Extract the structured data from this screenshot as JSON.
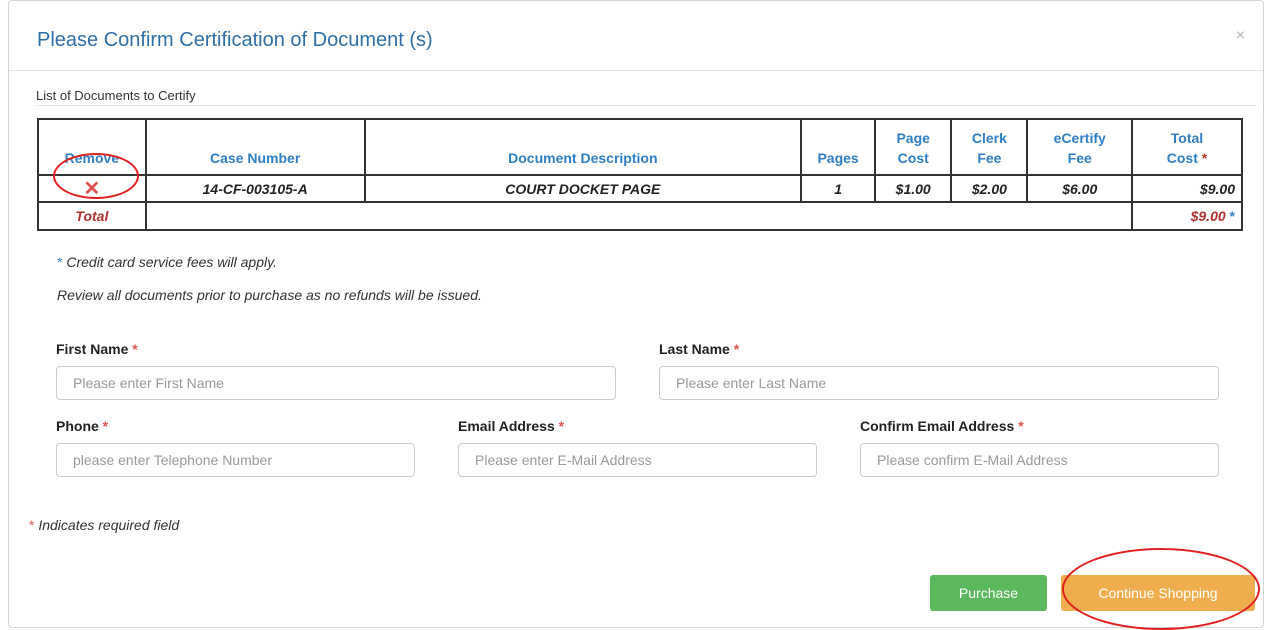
{
  "modal": {
    "title": "Please Confirm Certification of Document (s)",
    "close_glyph": "×"
  },
  "list": {
    "caption": "List of Documents to Certify",
    "headers": {
      "remove": "Remove",
      "case_number": "Case Number",
      "description": "Document Description",
      "pages": "Pages",
      "page_cost_1": "Page",
      "page_cost_2": "Cost",
      "clerk_fee_1": "Clerk",
      "clerk_fee_2": "Fee",
      "ecertify_fee_1": "eCertify",
      "ecertify_fee_2": "Fee",
      "total_cost_1": "Total",
      "total_cost_2": "Cost",
      "star": "*"
    },
    "rows": [
      {
        "remove_glyph": "✕",
        "case_number": "14-CF-003105-A",
        "description": "COURT DOCKET PAGE",
        "pages": "1",
        "page_cost": "$1.00",
        "clerk_fee": "$2.00",
        "ecertify_fee": "$6.00",
        "total_cost": "$9.00"
      }
    ],
    "total_label": "Total",
    "total_value": "$9.00",
    "total_star": "*"
  },
  "notes": {
    "star": "*",
    "credit_card": " Credit card service fees will apply.",
    "review": "Review all documents prior to purchase as no refunds will be issued."
  },
  "form": {
    "first_name": {
      "label": "First Name",
      "req": "*",
      "placeholder": "Please enter First Name",
      "value": ""
    },
    "last_name": {
      "label": "Last Name",
      "req": "*",
      "placeholder": "Please enter Last Name",
      "value": ""
    },
    "phone": {
      "label": "Phone",
      "req": "*",
      "placeholder": "please enter Telephone Number",
      "value": ""
    },
    "email": {
      "label": "Email Address",
      "req": "*",
      "placeholder": "Please enter E-Mail Address",
      "value": ""
    },
    "confirm_email": {
      "label": "Confirm Email Address",
      "req": "*",
      "placeholder": "Please confirm E-Mail Address",
      "value": ""
    }
  },
  "required_note": {
    "star": "*",
    "text": " Indicates required field"
  },
  "buttons": {
    "purchase": "Purchase",
    "continue_shopping": "Continue Shopping"
  },
  "colors": {
    "title": "#2f6fa8",
    "header_text": "#2f7fc6",
    "purchase_button": "#5cb85c",
    "continue_button": "#f0ad4e",
    "annotation_circle": "#e02020"
  }
}
